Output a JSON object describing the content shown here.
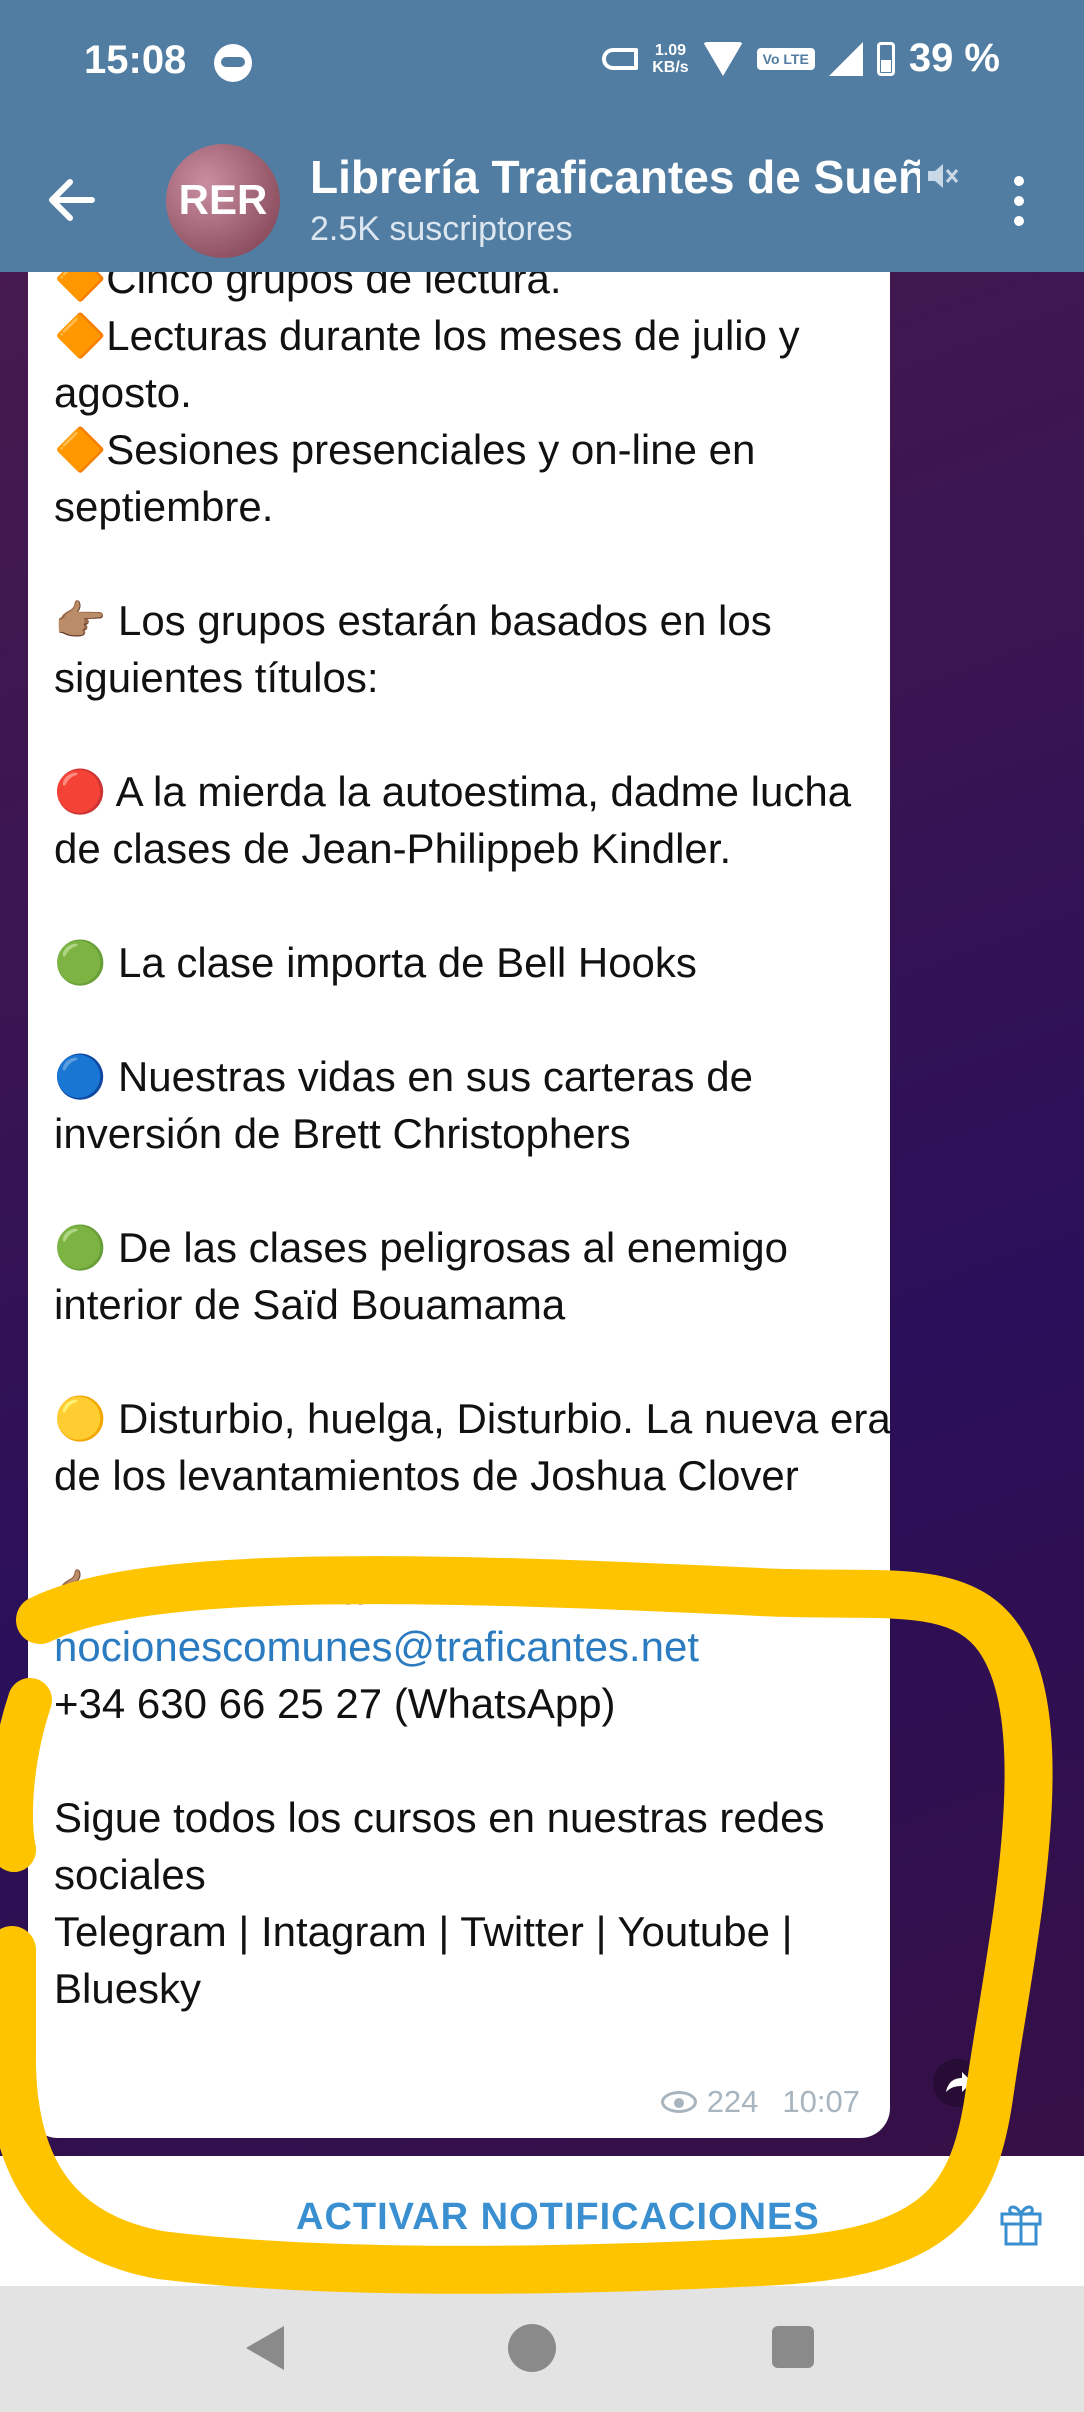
{
  "status_bar": {
    "time": "15:08",
    "net_speed_value": "1.09",
    "net_speed_unit": "KB/s",
    "volte": "Vo LTE",
    "battery": "39 %"
  },
  "header": {
    "avatar_text": "RER",
    "title": "Librería Traficantes de Sueñ",
    "subtitle": "2.5K suscriptores"
  },
  "message": {
    "lines": {
      "l0": "🔶Cinco grupos de lectura.",
      "l1": "🔶Lecturas durante los meses de julio y agosto.",
      "l2": "🔶Sesiones presenciales y on-line en septiembre.",
      "l3": "👉🏽 Los grupos estarán basados en los siguientes títulos:",
      "l4": "🔴 A la mierda la autoestima, dadme lucha de clases de Jean-Philippeb Kindler.",
      "l5": "🟢 La clase importa de Bell Hooks",
      "l6": "🔵 Nuestras vidas en sus carteras de inversión de Brett Christophers",
      "l7": "🟢  De las clases peligrosas al enemigo interior de Saïd Bouamama",
      "l8": "🟡 Disturbio, huelga, Disturbio. La nueva era de los levantamientos de Joshua Clover",
      "l9": "👉🏽 Escríbenos a",
      "email": "nocionescomunes@traficantes.net",
      "phone": "+34 630 66 25 27 (WhatsApp)",
      "l10": "Sigue todos los cursos en nuestras redes sociales",
      "l11": "Telegram | Intagram | Twitter | Youtube | Bluesky"
    },
    "views": "224",
    "time": "10:07"
  },
  "action_bar": {
    "label": "ACTIVAR NOTIFICACIONES"
  },
  "colors": {
    "header_bg": "#517da2",
    "link": "#2b7bc0",
    "highlight": "#ffc400"
  },
  "icons": [
    "back-arrow-icon",
    "mute-icon",
    "more-vert-icon",
    "eye-icon",
    "share-icon",
    "gift-icon"
  ]
}
